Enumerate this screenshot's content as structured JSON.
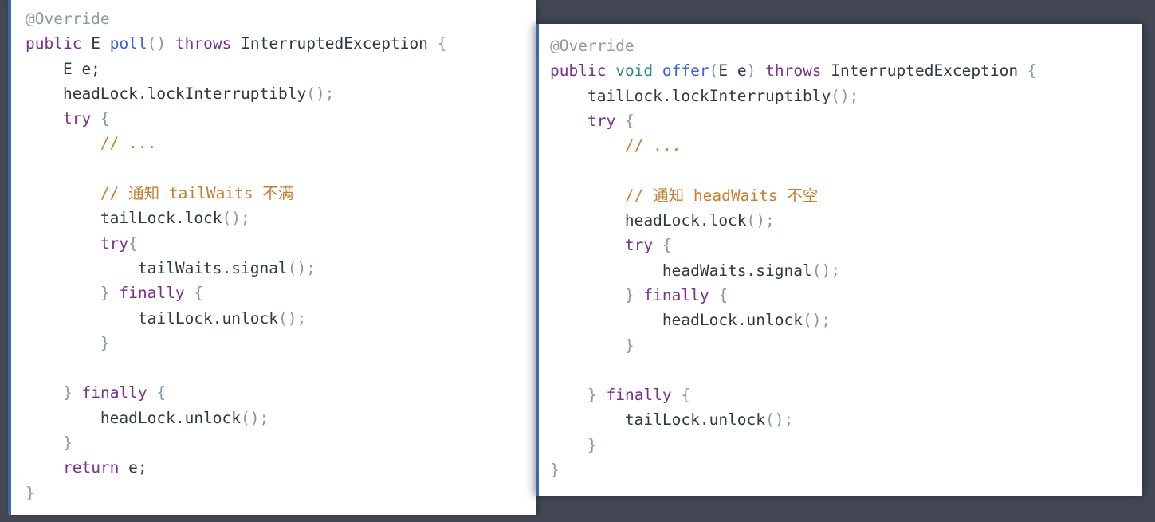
{
  "window": {
    "background_color": "#424753",
    "panel_background": "#ffffff",
    "panel_accent_border": "#3b6ba5"
  },
  "colors": {
    "keyword": "#7b2f8e",
    "type": "#2f8a80",
    "function": "#3c5fd8",
    "annotation": "#8f9aa8",
    "comment": "#c87d30",
    "punctuation": "#8796ab",
    "plain": "#2f3a46"
  },
  "panels": [
    {
      "id": "left",
      "name": "poll-method-snippet",
      "lines": [
        [
          {
            "t": "@Override",
            "c": "anno"
          }
        ],
        [
          {
            "t": "public",
            "c": "kw"
          },
          {
            "t": " ",
            "c": "plain"
          },
          {
            "t": "E",
            "c": "plain"
          },
          {
            "t": " ",
            "c": "plain"
          },
          {
            "t": "poll",
            "c": "fn"
          },
          {
            "t": "()",
            "c": "punct"
          },
          {
            "t": " ",
            "c": "plain"
          },
          {
            "t": "throws",
            "c": "kw"
          },
          {
            "t": " InterruptedException ",
            "c": "plain"
          },
          {
            "t": "{",
            "c": "punct"
          }
        ],
        [
          {
            "t": "    E e;",
            "c": "plain"
          }
        ],
        [
          {
            "t": "    headLock.lockInterruptibly",
            "c": "plain"
          },
          {
            "t": "();",
            "c": "punct"
          }
        ],
        [
          {
            "t": "    ",
            "c": "plain"
          },
          {
            "t": "try",
            "c": "kw"
          },
          {
            "t": " ",
            "c": "plain"
          },
          {
            "t": "{",
            "c": "punct"
          }
        ],
        [
          {
            "t": "        ",
            "c": "plain"
          },
          {
            "t": "// ...",
            "c": "cmt"
          }
        ],
        [
          {
            "t": "",
            "c": "plain"
          }
        ],
        [
          {
            "t": "        ",
            "c": "plain"
          },
          {
            "t": "// 通知 tailWaits 不满",
            "c": "cmt"
          }
        ],
        [
          {
            "t": "        tailLock.lock",
            "c": "plain"
          },
          {
            "t": "();",
            "c": "punct"
          }
        ],
        [
          {
            "t": "        ",
            "c": "plain"
          },
          {
            "t": "try",
            "c": "kw"
          },
          {
            "t": "{",
            "c": "punct"
          }
        ],
        [
          {
            "t": "            tailWaits.signal",
            "c": "plain"
          },
          {
            "t": "();",
            "c": "punct"
          }
        ],
        [
          {
            "t": "        ",
            "c": "plain"
          },
          {
            "t": "}",
            "c": "punct"
          },
          {
            "t": " ",
            "c": "plain"
          },
          {
            "t": "finally",
            "c": "kw"
          },
          {
            "t": " ",
            "c": "plain"
          },
          {
            "t": "{",
            "c": "punct"
          }
        ],
        [
          {
            "t": "            tailLock.unlock",
            "c": "plain"
          },
          {
            "t": "();",
            "c": "punct"
          }
        ],
        [
          {
            "t": "        ",
            "c": "plain"
          },
          {
            "t": "}",
            "c": "punct"
          }
        ],
        [
          {
            "t": "",
            "c": "plain"
          }
        ],
        [
          {
            "t": "    ",
            "c": "plain"
          },
          {
            "t": "}",
            "c": "punct"
          },
          {
            "t": " ",
            "c": "plain"
          },
          {
            "t": "finally",
            "c": "kw"
          },
          {
            "t": " ",
            "c": "plain"
          },
          {
            "t": "{",
            "c": "punct"
          }
        ],
        [
          {
            "t": "        headLock.unlock",
            "c": "plain"
          },
          {
            "t": "();",
            "c": "punct"
          }
        ],
        [
          {
            "t": "    ",
            "c": "plain"
          },
          {
            "t": "}",
            "c": "punct"
          }
        ],
        [
          {
            "t": "    ",
            "c": "plain"
          },
          {
            "t": "return",
            "c": "kw"
          },
          {
            "t": " e;",
            "c": "plain"
          }
        ],
        [
          {
            "t": "}",
            "c": "punct"
          }
        ]
      ]
    },
    {
      "id": "right",
      "name": "offer-method-snippet",
      "lines": [
        [
          {
            "t": "@Override",
            "c": "anno"
          }
        ],
        [
          {
            "t": "public",
            "c": "kw"
          },
          {
            "t": " ",
            "c": "plain"
          },
          {
            "t": "void",
            "c": "type"
          },
          {
            "t": " ",
            "c": "plain"
          },
          {
            "t": "offer",
            "c": "fn"
          },
          {
            "t": "(",
            "c": "punct"
          },
          {
            "t": "E e",
            "c": "plain"
          },
          {
            "t": ")",
            "c": "punct"
          },
          {
            "t": " ",
            "c": "plain"
          },
          {
            "t": "throws",
            "c": "kw"
          },
          {
            "t": " InterruptedException ",
            "c": "plain"
          },
          {
            "t": "{",
            "c": "punct"
          }
        ],
        [
          {
            "t": "    tailLock.lockInterruptibly",
            "c": "plain"
          },
          {
            "t": "();",
            "c": "punct"
          }
        ],
        [
          {
            "t": "    ",
            "c": "plain"
          },
          {
            "t": "try",
            "c": "kw"
          },
          {
            "t": " ",
            "c": "plain"
          },
          {
            "t": "{",
            "c": "punct"
          }
        ],
        [
          {
            "t": "        ",
            "c": "plain"
          },
          {
            "t": "// ...",
            "c": "cmt"
          }
        ],
        [
          {
            "t": "",
            "c": "plain"
          }
        ],
        [
          {
            "t": "        ",
            "c": "plain"
          },
          {
            "t": "// 通知 headWaits 不空",
            "c": "cmt"
          }
        ],
        [
          {
            "t": "        headLock.lock",
            "c": "plain"
          },
          {
            "t": "();",
            "c": "punct"
          }
        ],
        [
          {
            "t": "        ",
            "c": "plain"
          },
          {
            "t": "try",
            "c": "kw"
          },
          {
            "t": " ",
            "c": "plain"
          },
          {
            "t": "{",
            "c": "punct"
          }
        ],
        [
          {
            "t": "            headWaits.signal",
            "c": "plain"
          },
          {
            "t": "();",
            "c": "punct"
          }
        ],
        [
          {
            "t": "        ",
            "c": "plain"
          },
          {
            "t": "}",
            "c": "punct"
          },
          {
            "t": " ",
            "c": "plain"
          },
          {
            "t": "finally",
            "c": "kw"
          },
          {
            "t": " ",
            "c": "plain"
          },
          {
            "t": "{",
            "c": "punct"
          }
        ],
        [
          {
            "t": "            headLock.unlock",
            "c": "plain"
          },
          {
            "t": "();",
            "c": "punct"
          }
        ],
        [
          {
            "t": "        ",
            "c": "plain"
          },
          {
            "t": "}",
            "c": "punct"
          }
        ],
        [
          {
            "t": "",
            "c": "plain"
          }
        ],
        [
          {
            "t": "    ",
            "c": "plain"
          },
          {
            "t": "}",
            "c": "punct"
          },
          {
            "t": " ",
            "c": "plain"
          },
          {
            "t": "finally",
            "c": "kw"
          },
          {
            "t": " ",
            "c": "plain"
          },
          {
            "t": "{",
            "c": "punct"
          }
        ],
        [
          {
            "t": "        tailLock.unlock",
            "c": "plain"
          },
          {
            "t": "();",
            "c": "punct"
          }
        ],
        [
          {
            "t": "    ",
            "c": "plain"
          },
          {
            "t": "}",
            "c": "punct"
          }
        ],
        [
          {
            "t": "}",
            "c": "punct"
          }
        ]
      ]
    }
  ]
}
